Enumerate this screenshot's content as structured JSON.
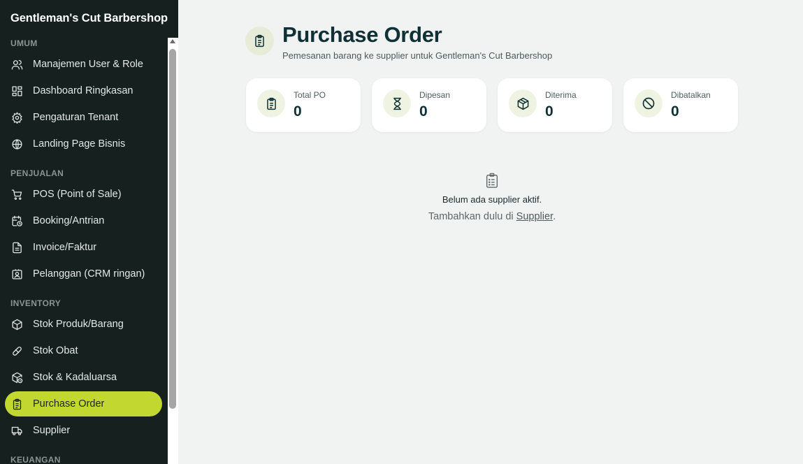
{
  "sidebar": {
    "brand": "Gentleman's Cut Barbershop",
    "sections": [
      {
        "label": "UMUM"
      },
      {
        "label": "PENJUALAN"
      },
      {
        "label": "INVENTORY"
      },
      {
        "label": "KEUANGAN"
      }
    ],
    "items": [
      {
        "label": "Manajemen User & Role",
        "icon": "users-icon"
      },
      {
        "label": "Dashboard Ringkasan",
        "icon": "dashboard-grid-icon"
      },
      {
        "label": "Pengaturan Tenant",
        "icon": "gear-icon"
      },
      {
        "label": "Landing Page Bisnis",
        "icon": "globe-icon"
      },
      {
        "label": "POS (Point of Sale)",
        "icon": "cart-icon"
      },
      {
        "label": "Booking/Antrian",
        "icon": "calendar-clock-icon"
      },
      {
        "label": "Invoice/Faktur",
        "icon": "document-icon"
      },
      {
        "label": "Pelanggan (CRM ringan)",
        "icon": "contact-card-icon"
      },
      {
        "label": "Stok Produk/Barang",
        "icon": "box-icon"
      },
      {
        "label": "Stok Obat",
        "icon": "pill-icon"
      },
      {
        "label": "Stok & Kadaluarsa",
        "icon": "box-clock-icon"
      },
      {
        "label": "Purchase Order",
        "icon": "clipboard-list-icon",
        "active": true
      },
      {
        "label": "Supplier",
        "icon": "truck-icon"
      }
    ],
    "active_color": "#c2d830"
  },
  "header": {
    "title": "Purchase Order",
    "subtitle": "Pemesanan barang ke supplier untuk Gentleman's Cut Barbershop",
    "icon": "clipboard-list-icon"
  },
  "stats": [
    {
      "label": "Total PO",
      "value": "0",
      "icon": "clipboard-list-icon"
    },
    {
      "label": "Dipesan",
      "value": "0",
      "icon": "hourglass-icon"
    },
    {
      "label": "Diterima",
      "value": "0",
      "icon": "package-icon"
    },
    {
      "label": "Dibatalkan",
      "value": "0",
      "icon": "ban-icon"
    }
  ],
  "empty_state": {
    "icon": "clipboard-list-icon",
    "title": "Belum ada supplier aktif.",
    "sub_prefix": "Tambahkan dulu di ",
    "link_label": "Supplier",
    "sub_suffix": "."
  }
}
